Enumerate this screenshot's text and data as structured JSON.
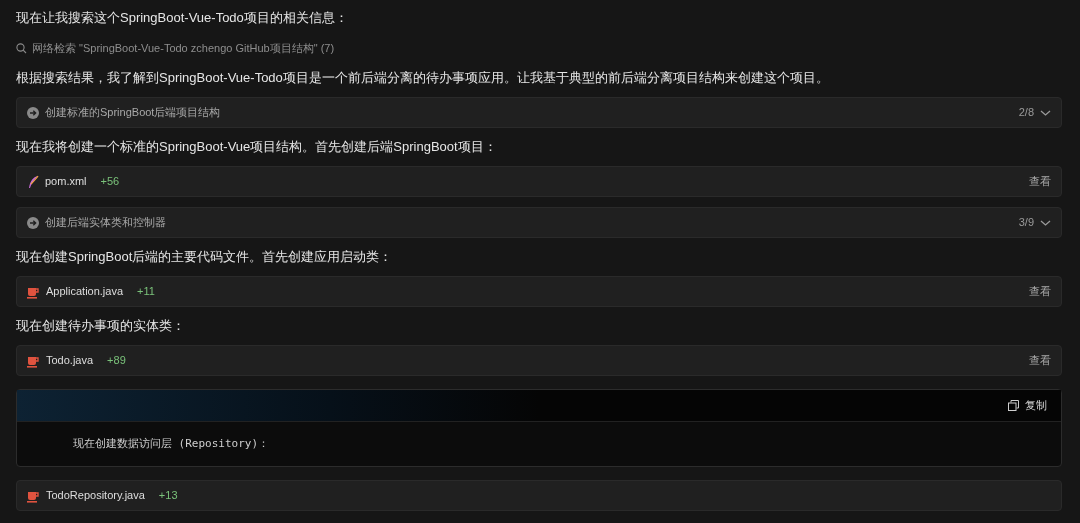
{
  "items": [
    {
      "kind": "text",
      "text": "现在让我搜索这个SpringBoot-Vue-Todo项目的相关信息："
    },
    {
      "kind": "search",
      "text": "网络检索 \"SpringBoot-Vue-Todo zchengo GitHub项目结构\" (7)"
    },
    {
      "kind": "text",
      "text": "根据搜索结果，我了解到SpringBoot-Vue-Todo项目是一个前后端分离的待办事项应用。让我基于典型的前后端分离项目结构来创建这个项目。"
    },
    {
      "kind": "step",
      "text": "创建标准的SpringBoot后端项目结构",
      "count": "2/8",
      "expanded": false
    },
    {
      "kind": "text",
      "text": "现在我将创建一个标准的SpringBoot-Vue项目结构。首先创建后端SpringBoot项目："
    },
    {
      "kind": "xml_file",
      "name": "pom.xml",
      "diff": "+56",
      "action": "查看"
    },
    {
      "kind": "step",
      "text": "创建后端实体类和控制器",
      "count": "3/9",
      "expanded": false
    },
    {
      "kind": "text",
      "text": "现在创建SpringBoot后端的主要代码文件。首先创建应用启动类："
    },
    {
      "kind": "java_file",
      "name": "Application.java",
      "diff": "+11",
      "action": "查看"
    },
    {
      "kind": "text",
      "text": "现在创建待办事项的实体类："
    },
    {
      "kind": "java_file",
      "name": "Todo.java",
      "diff": "+89",
      "action": "查看"
    },
    {
      "kind": "code",
      "copy_label": "复制",
      "code": "现在创建数据访问层 (Repository)："
    },
    {
      "kind": "java_file",
      "name": "TodoRepository.java",
      "diff": "+13"
    }
  ]
}
